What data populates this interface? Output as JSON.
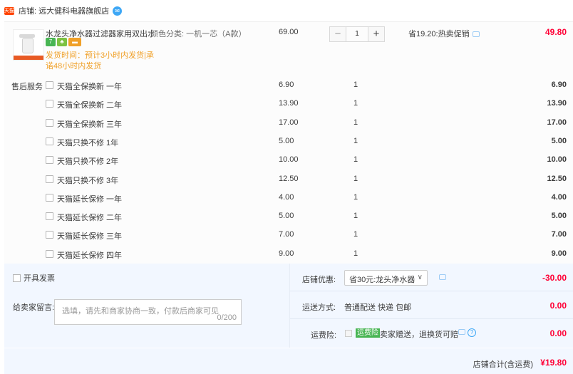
{
  "shop": {
    "logo_text": "天猫",
    "name": "店铺: 远大健科电器旗舰店"
  },
  "product": {
    "name": "水龙头净水器过滤器家用双出水...",
    "sku": "颜色分类: 一机一芯（A款）",
    "badge_icons": [
      "seven-day-return-icon",
      "leaf-icon",
      "card-icon"
    ],
    "badge_labels": [
      "7",
      "",
      ""
    ],
    "shipping_line1": "发货时间：预计3小时内发货|承",
    "shipping_line2": "诺48小时内发货",
    "price": "69.00",
    "quantity": "1",
    "promo": "省19.20:热卖促销",
    "final_price": "49.80"
  },
  "after_sales_label": "售后服务",
  "services": [
    {
      "name": "天猫全保换新 一年",
      "price": "6.90",
      "qty": "1",
      "total": "6.90"
    },
    {
      "name": "天猫全保换新 二年",
      "price": "13.90",
      "qty": "1",
      "total": "13.90"
    },
    {
      "name": "天猫全保换新 三年",
      "price": "17.00",
      "qty": "1",
      "total": "17.00"
    },
    {
      "name": "天猫只换不修 1年",
      "price": "5.00",
      "qty": "1",
      "total": "5.00"
    },
    {
      "name": "天猫只换不修 2年",
      "price": "10.00",
      "qty": "1",
      "total": "10.00"
    },
    {
      "name": "天猫只换不修 3年",
      "price": "12.50",
      "qty": "1",
      "total": "12.50"
    },
    {
      "name": "天猫延长保修 一年",
      "price": "4.00",
      "qty": "1",
      "total": "4.00"
    },
    {
      "name": "天猫延长保修 二年",
      "price": "5.00",
      "qty": "1",
      "total": "5.00"
    },
    {
      "name": "天猫延长保修 三年",
      "price": "7.00",
      "qty": "1",
      "total": "7.00"
    },
    {
      "name": "天猫延长保修 四年",
      "price": "9.00",
      "qty": "1",
      "total": "9.00"
    }
  ],
  "invoice_label": "开具发票",
  "memo": {
    "label": "给卖家留言:",
    "placeholder": "选填，请先和商家协商一致，付款后商家可见",
    "count": "0/200"
  },
  "coupon": {
    "label": "店铺优惠:",
    "selected": "省30元:龙头净水器",
    "value": "-30.00"
  },
  "delivery": {
    "label": "运送方式:",
    "method": "普通配送 快递 包邮",
    "value": "0.00"
  },
  "insurance": {
    "label": "运费险:",
    "badge": "运费险",
    "text": "卖家赠送，退换货可赔",
    "value": "0.00"
  },
  "total": {
    "label": "店铺合计(含运费)",
    "value": "¥19.80"
  }
}
